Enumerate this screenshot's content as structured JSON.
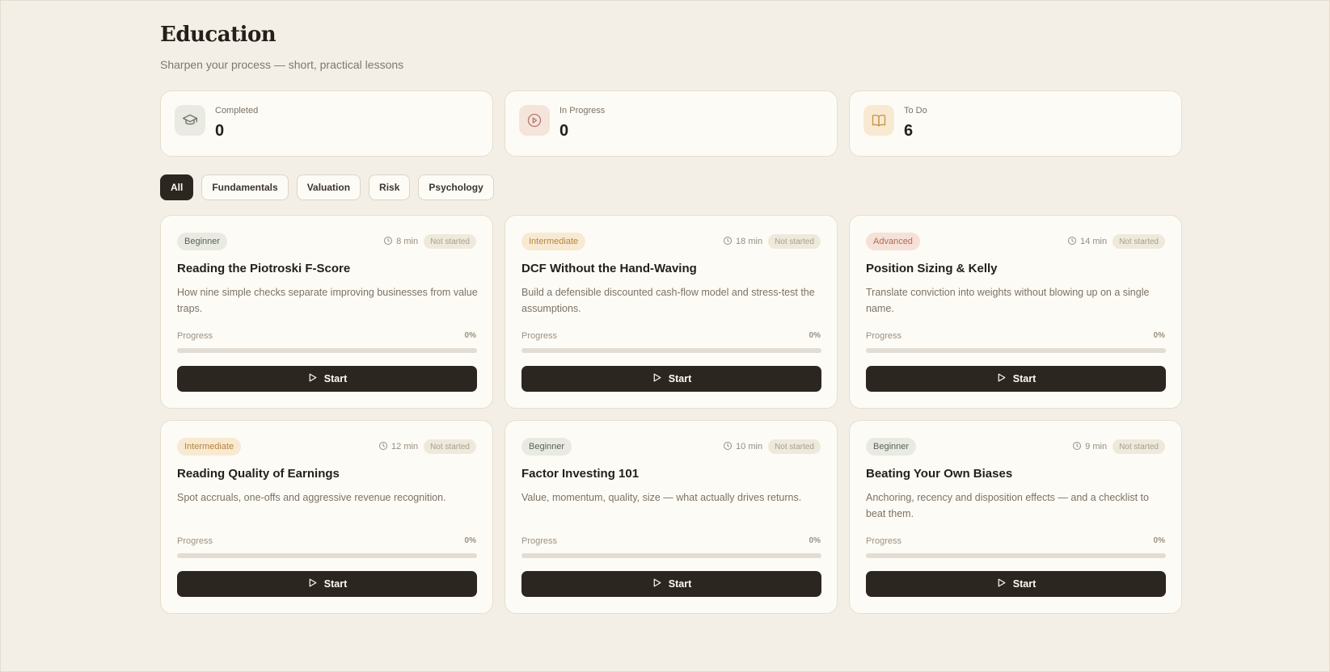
{
  "header": {
    "title": "Education",
    "subtitle": "Sharpen your process — short, practical lessons"
  },
  "stats": [
    {
      "label": "Completed",
      "value": "0",
      "icon": "graduation-cap-icon",
      "icon_bg": "#e9ebe2",
      "icon_color": "#6b6f64"
    },
    {
      "label": "In Progress",
      "value": "0",
      "icon": "play-circle-icon",
      "icon_bg": "#f5e4dc",
      "icon_color": "#b5786a"
    },
    {
      "label": "To Do",
      "value": "6",
      "icon": "book-open-icon",
      "icon_bg": "#f8ead2",
      "icon_color": "#c79448"
    }
  ],
  "filters": [
    "All",
    "Fundamentals",
    "Valuation",
    "Risk",
    "Psychology"
  ],
  "active_filter": "All",
  "level_colors": {
    "Beginner": {
      "bg": "#e9ebe2",
      "fg": "#5c6157"
    },
    "Intermediate": {
      "bg": "#f8ead2",
      "fg": "#b6843c"
    },
    "Advanced": {
      "bg": "#f5e1d8",
      "fg": "#b36a55"
    }
  },
  "progress_label": "Progress",
  "start_label": "Start",
  "lessons": [
    {
      "level": "Beginner",
      "duration": "8 min",
      "status": "Not started",
      "title": "Reading the Piotroski F-Score",
      "description": "How nine simple checks separate improving businesses from value traps.",
      "progress_text": "0%",
      "progress": 0
    },
    {
      "level": "Intermediate",
      "duration": "18 min",
      "status": "Not started",
      "title": "DCF Without the Hand-Waving",
      "description": "Build a defensible discounted cash-flow model and stress-test the assumptions.",
      "progress_text": "0%",
      "progress": 0
    },
    {
      "level": "Advanced",
      "duration": "14 min",
      "status": "Not started",
      "title": "Position Sizing & Kelly",
      "description": "Translate conviction into weights without blowing up on a single name.",
      "progress_text": "0%",
      "progress": 0
    },
    {
      "level": "Intermediate",
      "duration": "12 min",
      "status": "Not started",
      "title": "Reading Quality of Earnings",
      "description": "Spot accruals, one-offs and aggressive revenue recognition.",
      "progress_text": "0%",
      "progress": 0
    },
    {
      "level": "Beginner",
      "duration": "10 min",
      "status": "Not started",
      "title": "Factor Investing 101",
      "description": "Value, momentum, quality, size — what actually drives returns.",
      "progress_text": "0%",
      "progress": 0
    },
    {
      "level": "Beginner",
      "duration": "9 min",
      "status": "Not started",
      "title": "Beating Your Own Biases",
      "description": "Anchoring, recency and disposition effects — and a checklist to beat them.",
      "progress_text": "0%",
      "progress": 0
    }
  ]
}
